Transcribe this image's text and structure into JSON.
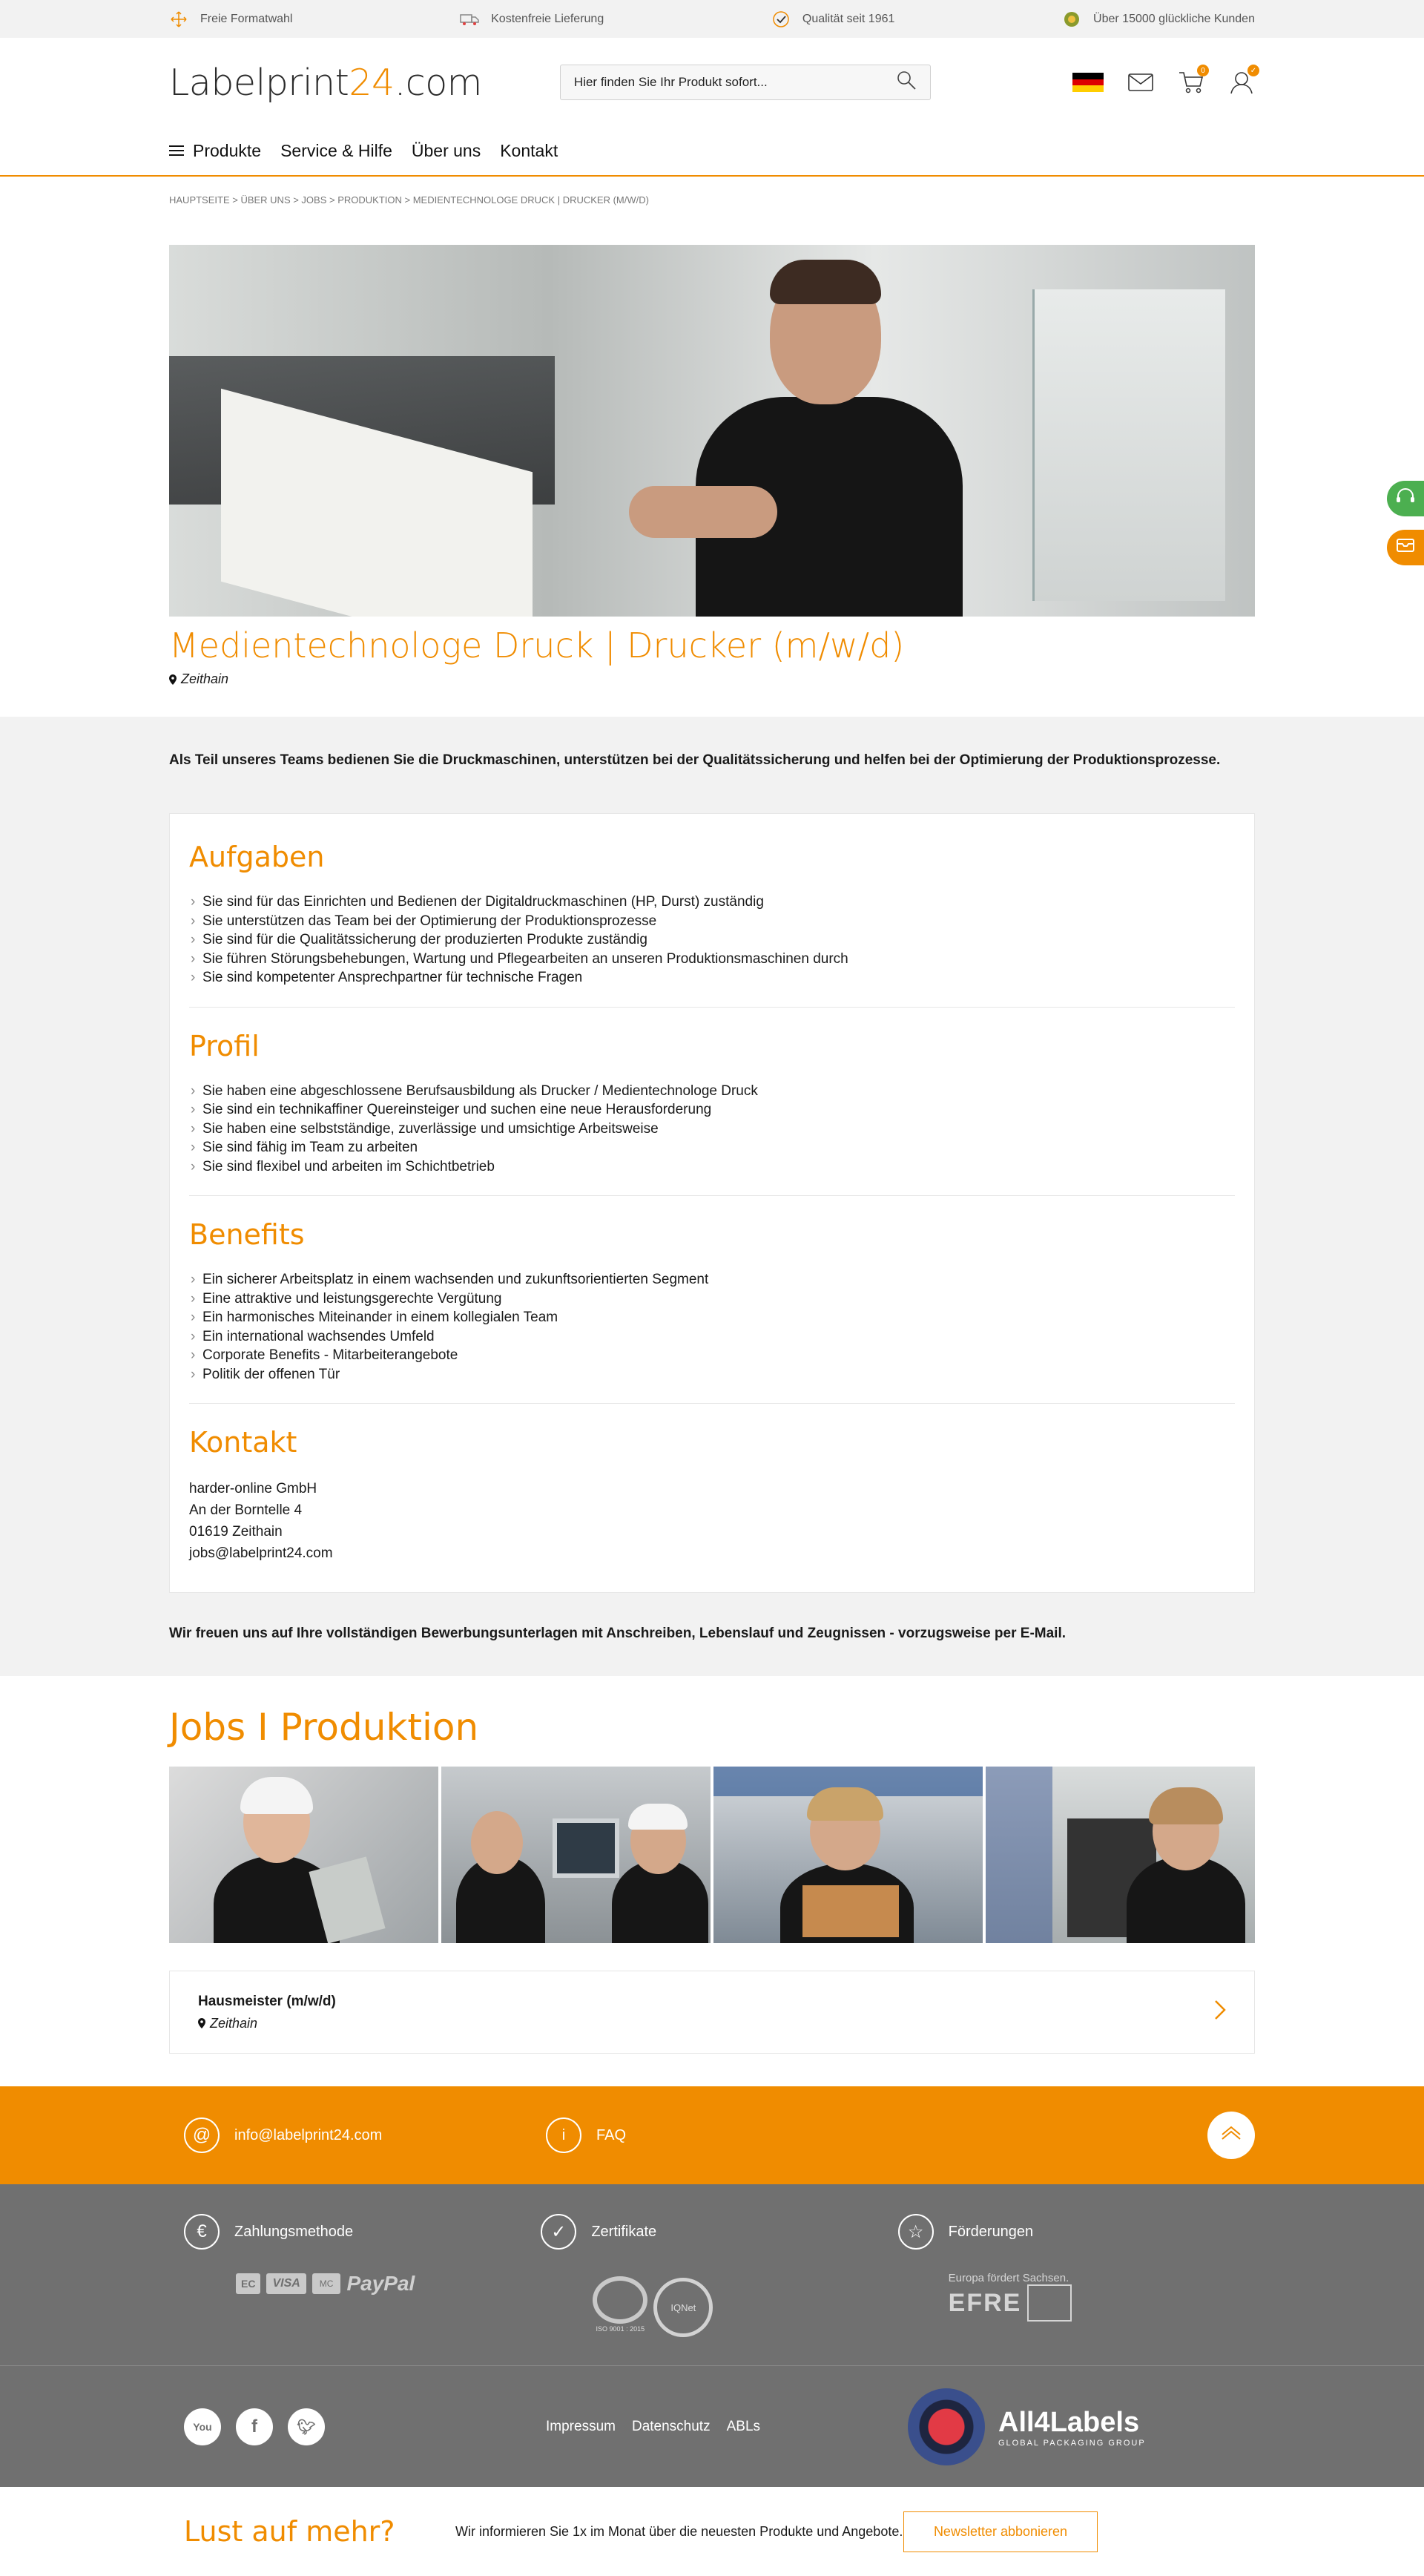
{
  "topbar": {
    "usps": [
      {
        "label": "Freie Formatwahl",
        "icon": "resize-arrows-icon"
      },
      {
        "label": "Kostenfreie Lieferung",
        "icon": "delivery-truck-icon"
      },
      {
        "label": "Qualität seit 1961",
        "icon": "quality-check-icon"
      },
      {
        "label": "Über 15000 glückliche Kunden",
        "icon": "happy-customer-icon"
      }
    ]
  },
  "header": {
    "logo_main": "Labelprint",
    "logo_accent": "24",
    "logo_tail": ".com",
    "search_placeholder": "Hier finden Sie Ihr Produkt sofort...",
    "cart_count": "0",
    "account_badge": "✓"
  },
  "nav": {
    "items": [
      "Produkte",
      "Service & Hilfe",
      "Über uns",
      "Kontakt"
    ]
  },
  "breadcrumb": "Hauptseite > Über uns > Jobs > Produktion > Medientechnologe Druck | Drucker (m/w/d)",
  "job": {
    "title": "Medientechnologe Druck | Drucker (m/w/d)",
    "location": "Zeithain",
    "intro": "Als Teil unseres Teams bedienen Sie die Druckmaschinen, unterstützen bei der Qualitätssicherung und helfen bei der Optimierung der Produktionsprozesse.",
    "sections": {
      "tasks": {
        "heading": "Aufgaben",
        "items": [
          "Sie sind für das Einrichten und Bedienen der Digitaldruckmaschinen (HP, Durst) zuständig",
          "Sie unterstützen das Team bei der Optimierung der Produktionsprozesse",
          "Sie sind für die Qualitätssicherung der produzierten Produkte zuständig",
          "Sie führen Störungsbehebungen, Wartung und Pflegearbeiten an unseren Produktionsmaschinen durch",
          "Sie sind kompetenter Ansprechpartner für technische Fragen"
        ]
      },
      "profile": {
        "heading": "Profil",
        "items": [
          "Sie haben eine abgeschlossene Berufsausbildung als Drucker / Medientechnologe Druck",
          "Sie sind ein technikaffiner Quereinsteiger und suchen eine neue Herausforderung",
          "Sie haben eine selbstständige, zuverlässige und umsichtige Arbeitsweise",
          "Sie sind fähig im Team zu arbeiten",
          "Sie sind flexibel und arbeiten im Schichtbetrieb"
        ]
      },
      "benefits": {
        "heading": "Benefits",
        "items": [
          "Ein sicherer Arbeitsplatz in einem wachsenden und zukunftsorientierten Segment",
          "Eine attraktive und leistungsgerechte Vergütung",
          "Ein harmonisches Miteinander in einem kollegialen Team",
          "Ein international wachsendes Umfeld",
          "Corporate Benefits - Mitarbeiterangebote",
          "Politik der offenen Tür"
        ]
      },
      "contact": {
        "heading": "Kontakt",
        "company": "harder-online GmbH",
        "street": "An der Borntelle 4",
        "city": "01619 Zeithain",
        "email": "jobs@labelprint24.com"
      }
    },
    "closing": "Wir freuen uns auf Ihre vollständigen Bewerbungsunterlagen mit Anschreiben, Lebenslauf und Zeugnissen - vorzugsweise per E-Mail."
  },
  "jobs_section": {
    "heading": "Jobs I Produktion",
    "listing": {
      "title": "Hausmeister (m/w/d)",
      "location": "Zeithain"
    }
  },
  "footer": {
    "email": "info@labelprint24.com",
    "faq": "FAQ",
    "payment_heading": "Zahlungsmethode",
    "payment_logos": [
      "EC",
      "VISA",
      "MC",
      "PayPal"
    ],
    "cert_heading": "Zertifikate",
    "cert_caption": "ISO 9001 : 2015",
    "cert_logo_text": "IQNet",
    "funding_heading": "Förderungen",
    "funding_text_top": "Europa fördert Sachsen.",
    "funding_text_main": "EFRE",
    "links": [
      "Impressum",
      "Datenschutz",
      "ABLs"
    ],
    "brand_main": "All4Labels",
    "brand_sub": "GLOBAL PACKAGING GROUP",
    "social": [
      "youtube-icon",
      "facebook-icon",
      "twitter-icon"
    ]
  },
  "newsletter": {
    "heading": "Lust auf mehr?",
    "text": "Wir informieren Sie 1x im Monat über die neuesten Produkte und Angebote.",
    "button": "Newsletter abbonieren"
  },
  "colors": {
    "accent": "#f08c00",
    "footer_gray": "#707070",
    "section_gray": "#f2f2f2",
    "side_green": "#4caf50"
  }
}
